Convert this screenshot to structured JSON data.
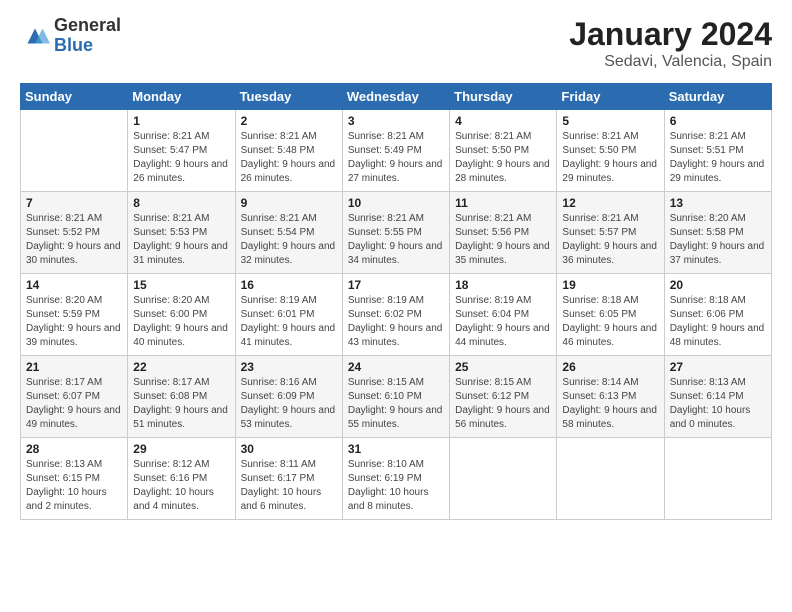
{
  "logo": {
    "general": "General",
    "blue": "Blue"
  },
  "header": {
    "title": "January 2024",
    "subtitle": "Sedavi, Valencia, Spain"
  },
  "weekdays": [
    "Sunday",
    "Monday",
    "Tuesday",
    "Wednesday",
    "Thursday",
    "Friday",
    "Saturday"
  ],
  "weeks": [
    [
      {
        "day": "",
        "sunrise": "",
        "sunset": "",
        "daylight": ""
      },
      {
        "day": "1",
        "sunrise": "Sunrise: 8:21 AM",
        "sunset": "Sunset: 5:47 PM",
        "daylight": "Daylight: 9 hours and 26 minutes."
      },
      {
        "day": "2",
        "sunrise": "Sunrise: 8:21 AM",
        "sunset": "Sunset: 5:48 PM",
        "daylight": "Daylight: 9 hours and 26 minutes."
      },
      {
        "day": "3",
        "sunrise": "Sunrise: 8:21 AM",
        "sunset": "Sunset: 5:49 PM",
        "daylight": "Daylight: 9 hours and 27 minutes."
      },
      {
        "day": "4",
        "sunrise": "Sunrise: 8:21 AM",
        "sunset": "Sunset: 5:50 PM",
        "daylight": "Daylight: 9 hours and 28 minutes."
      },
      {
        "day": "5",
        "sunrise": "Sunrise: 8:21 AM",
        "sunset": "Sunset: 5:50 PM",
        "daylight": "Daylight: 9 hours and 29 minutes."
      },
      {
        "day": "6",
        "sunrise": "Sunrise: 8:21 AM",
        "sunset": "Sunset: 5:51 PM",
        "daylight": "Daylight: 9 hours and 29 minutes."
      }
    ],
    [
      {
        "day": "7",
        "sunrise": "Sunrise: 8:21 AM",
        "sunset": "Sunset: 5:52 PM",
        "daylight": "Daylight: 9 hours and 30 minutes."
      },
      {
        "day": "8",
        "sunrise": "Sunrise: 8:21 AM",
        "sunset": "Sunset: 5:53 PM",
        "daylight": "Daylight: 9 hours and 31 minutes."
      },
      {
        "day": "9",
        "sunrise": "Sunrise: 8:21 AM",
        "sunset": "Sunset: 5:54 PM",
        "daylight": "Daylight: 9 hours and 32 minutes."
      },
      {
        "day": "10",
        "sunrise": "Sunrise: 8:21 AM",
        "sunset": "Sunset: 5:55 PM",
        "daylight": "Daylight: 9 hours and 34 minutes."
      },
      {
        "day": "11",
        "sunrise": "Sunrise: 8:21 AM",
        "sunset": "Sunset: 5:56 PM",
        "daylight": "Daylight: 9 hours and 35 minutes."
      },
      {
        "day": "12",
        "sunrise": "Sunrise: 8:21 AM",
        "sunset": "Sunset: 5:57 PM",
        "daylight": "Daylight: 9 hours and 36 minutes."
      },
      {
        "day": "13",
        "sunrise": "Sunrise: 8:20 AM",
        "sunset": "Sunset: 5:58 PM",
        "daylight": "Daylight: 9 hours and 37 minutes."
      }
    ],
    [
      {
        "day": "14",
        "sunrise": "Sunrise: 8:20 AM",
        "sunset": "Sunset: 5:59 PM",
        "daylight": "Daylight: 9 hours and 39 minutes."
      },
      {
        "day": "15",
        "sunrise": "Sunrise: 8:20 AM",
        "sunset": "Sunset: 6:00 PM",
        "daylight": "Daylight: 9 hours and 40 minutes."
      },
      {
        "day": "16",
        "sunrise": "Sunrise: 8:19 AM",
        "sunset": "Sunset: 6:01 PM",
        "daylight": "Daylight: 9 hours and 41 minutes."
      },
      {
        "day": "17",
        "sunrise": "Sunrise: 8:19 AM",
        "sunset": "Sunset: 6:02 PM",
        "daylight": "Daylight: 9 hours and 43 minutes."
      },
      {
        "day": "18",
        "sunrise": "Sunrise: 8:19 AM",
        "sunset": "Sunset: 6:04 PM",
        "daylight": "Daylight: 9 hours and 44 minutes."
      },
      {
        "day": "19",
        "sunrise": "Sunrise: 8:18 AM",
        "sunset": "Sunset: 6:05 PM",
        "daylight": "Daylight: 9 hours and 46 minutes."
      },
      {
        "day": "20",
        "sunrise": "Sunrise: 8:18 AM",
        "sunset": "Sunset: 6:06 PM",
        "daylight": "Daylight: 9 hours and 48 minutes."
      }
    ],
    [
      {
        "day": "21",
        "sunrise": "Sunrise: 8:17 AM",
        "sunset": "Sunset: 6:07 PM",
        "daylight": "Daylight: 9 hours and 49 minutes."
      },
      {
        "day": "22",
        "sunrise": "Sunrise: 8:17 AM",
        "sunset": "Sunset: 6:08 PM",
        "daylight": "Daylight: 9 hours and 51 minutes."
      },
      {
        "day": "23",
        "sunrise": "Sunrise: 8:16 AM",
        "sunset": "Sunset: 6:09 PM",
        "daylight": "Daylight: 9 hours and 53 minutes."
      },
      {
        "day": "24",
        "sunrise": "Sunrise: 8:15 AM",
        "sunset": "Sunset: 6:10 PM",
        "daylight": "Daylight: 9 hours and 55 minutes."
      },
      {
        "day": "25",
        "sunrise": "Sunrise: 8:15 AM",
        "sunset": "Sunset: 6:12 PM",
        "daylight": "Daylight: 9 hours and 56 minutes."
      },
      {
        "day": "26",
        "sunrise": "Sunrise: 8:14 AM",
        "sunset": "Sunset: 6:13 PM",
        "daylight": "Daylight: 9 hours and 58 minutes."
      },
      {
        "day": "27",
        "sunrise": "Sunrise: 8:13 AM",
        "sunset": "Sunset: 6:14 PM",
        "daylight": "Daylight: 10 hours and 0 minutes."
      }
    ],
    [
      {
        "day": "28",
        "sunrise": "Sunrise: 8:13 AM",
        "sunset": "Sunset: 6:15 PM",
        "daylight": "Daylight: 10 hours and 2 minutes."
      },
      {
        "day": "29",
        "sunrise": "Sunrise: 8:12 AM",
        "sunset": "Sunset: 6:16 PM",
        "daylight": "Daylight: 10 hours and 4 minutes."
      },
      {
        "day": "30",
        "sunrise": "Sunrise: 8:11 AM",
        "sunset": "Sunset: 6:17 PM",
        "daylight": "Daylight: 10 hours and 6 minutes."
      },
      {
        "day": "31",
        "sunrise": "Sunrise: 8:10 AM",
        "sunset": "Sunset: 6:19 PM",
        "daylight": "Daylight: 10 hours and 8 minutes."
      },
      {
        "day": "",
        "sunrise": "",
        "sunset": "",
        "daylight": ""
      },
      {
        "day": "",
        "sunrise": "",
        "sunset": "",
        "daylight": ""
      },
      {
        "day": "",
        "sunrise": "",
        "sunset": "",
        "daylight": ""
      }
    ]
  ]
}
